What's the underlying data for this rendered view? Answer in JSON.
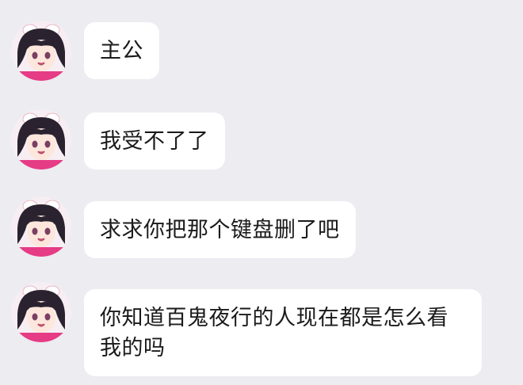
{
  "colors": {
    "background": "#ececf1",
    "bubble": "#ffffff",
    "text": "#1a1a1a"
  },
  "messages": [
    {
      "text": "主公",
      "avatar_icon": "anime-girl-avatar-icon"
    },
    {
      "text": "我受不了了",
      "avatar_icon": "anime-girl-avatar-icon"
    },
    {
      "text": "求求你把那个键盘删了吧",
      "avatar_icon": "anime-girl-avatar-icon"
    },
    {
      "text": "你知道百鬼夜行的人现在都是怎么看我的吗",
      "avatar_icon": "anime-girl-avatar-icon"
    }
  ]
}
